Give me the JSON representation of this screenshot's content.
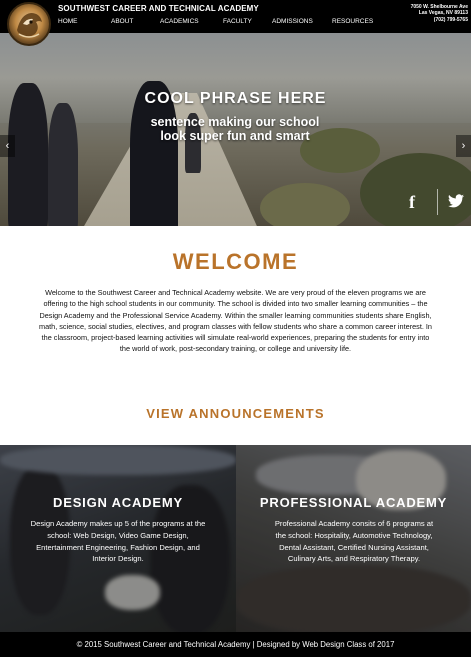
{
  "header": {
    "school_name": "SOUTHWEST CAREER AND TECHNICAL ACADEMY",
    "address_line1": "7050 W. Shelbourne Ave",
    "address_line2": "Las Vegas, NV 89113",
    "phone": "(702) 799-5765",
    "nav": [
      {
        "label": "HOME"
      },
      {
        "label": "ABOUT"
      },
      {
        "label": "ACADEMICS"
      },
      {
        "label": "FACULTY"
      },
      {
        "label": "ADMISSIONS"
      },
      {
        "label": "RESOURCES"
      }
    ]
  },
  "hero": {
    "title": "COOL PHRASE HERE",
    "subtitle": "sentence making our school look super fun and smart",
    "prev_arrow": "‹",
    "next_arrow": "›",
    "facebook_glyph": "f"
  },
  "welcome": {
    "title": "WELCOME",
    "body": "Welcome to the Southwest Career and Technical Academy website. We are very proud of the eleven programs we are offering to the high school students in our community. The school is divided into two smaller learning communities – the Design Academy and the Professional Service Academy. Within the smaller learning communities students share English, math, science, social studies, electives, and program classes with fellow students who share a common career interest. In the classroom, project-based learning activities will simulate real-world experiences, preparing the students for entry into the world of work, post-secondary training, or college and university life.",
    "announcements_link": "VIEW ANNOUNCEMENTS"
  },
  "academies": {
    "design": {
      "title": "DESIGN ACADEMY",
      "text": "Design Academy makes up 5 of the programs at the school: Web Design, Video Game Design, Entertainment Engineering, Fashion Design, and Interior Design."
    },
    "professional": {
      "title": "PROFESSIONAL ACADEMY",
      "text": "Professional Academy consits of 6 programs at the school: Hospitality, Automotive Technology, Dental Assistant, Certified Nursing Assistant, Culinary Arts, and Respiratory Therapy."
    }
  },
  "footer": {
    "text": "© 2015 Southwest Career and Technical Academy | Designed by Web Design Class of 2017"
  },
  "colors": {
    "accent": "#b9732a",
    "header_bg": "#000000",
    "footer_bg": "#000000"
  }
}
